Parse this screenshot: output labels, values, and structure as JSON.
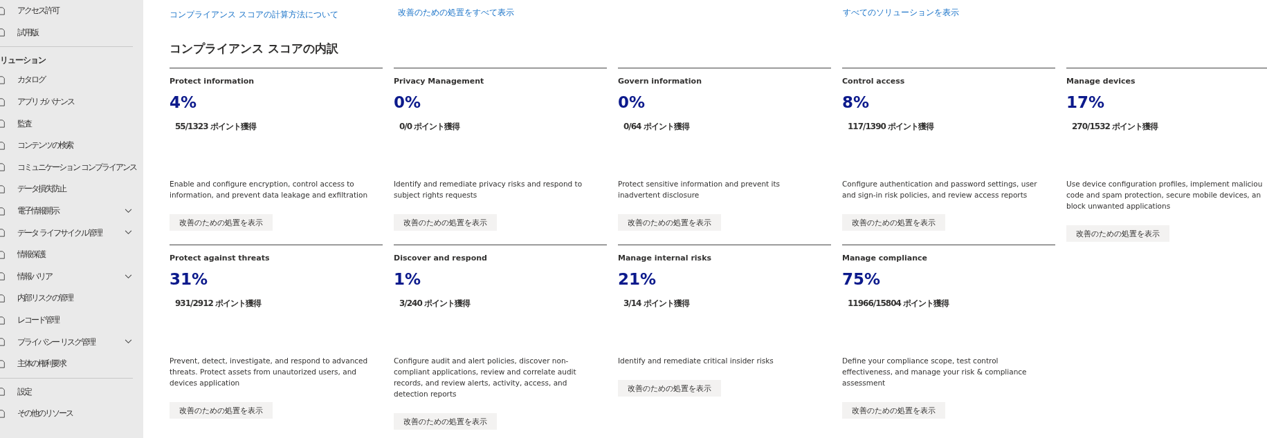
{
  "sidebar": {
    "top_items": [
      {
        "label": "アクセス許可"
      },
      {
        "label": "試用版"
      }
    ],
    "section_title": "リューション",
    "items": [
      {
        "label": "カタログ",
        "kind": "link"
      },
      {
        "label": "アプリ ガバナンス",
        "kind": "link"
      },
      {
        "label": "監査",
        "kind": "link"
      },
      {
        "label": "コンテンツの検索",
        "kind": "link"
      },
      {
        "label": "コミュニケーション コンプライアンス",
        "kind": "link"
      },
      {
        "label": "データ損失防止",
        "kind": "link"
      },
      {
        "label": "電子情報開示",
        "kind": "group"
      },
      {
        "label": "データ ライフサイクル管理",
        "kind": "group"
      },
      {
        "label": "情報保護",
        "kind": "link"
      },
      {
        "label": "情報バリア",
        "kind": "group"
      },
      {
        "label": "内部リスクの管理",
        "kind": "link"
      },
      {
        "label": "レコード管理",
        "kind": "link"
      },
      {
        "label": "プライバシー リスク管理",
        "kind": "group"
      },
      {
        "label": "主体の権利要求",
        "kind": "link"
      }
    ],
    "bottom_items": [
      {
        "label": "設定"
      },
      {
        "label": "その他のリソース"
      }
    ]
  },
  "links": [
    "コンプライアンス スコアの計算方法について",
    "改善のための処置をすべて表示",
    "すべてのソリューションを表示"
  ],
  "heading": "コンプライアンス スコアの内訳",
  "cards": [
    {
      "title": "Protect information",
      "percent": "4%",
      "points": "55/1323 ポイント獲得",
      "description": [
        "Enable and configure encryption, control access to",
        "information, and prevent data leakage and exfiltration"
      ],
      "button": "改善のための処置を表示"
    },
    {
      "title": "Privacy Management",
      "percent": "0%",
      "points": "0/0 ポイント獲得",
      "description": [
        "Identify and remediate privacy risks and respond to",
        "subject rights requests"
      ],
      "button": "改善のための処置を表示"
    },
    {
      "title": "Govern information",
      "percent": "0%",
      "points": "0/64 ポイント獲得",
      "description": [
        "Protect sensitive information and prevent its",
        "inadvertent disclosure"
      ],
      "button": "改善のための処置を表示"
    },
    {
      "title": "Control access",
      "percent": "8%",
      "points": "117/1390 ポイント獲得",
      "description": [
        "Configure authentication and password settings, user",
        "and sign-in risk policies, and review access reports"
      ],
      "button": "改善のための処置を表示"
    },
    {
      "title": "Manage devices",
      "percent": "17%",
      "points": "270/1532 ポイント獲得",
      "description": [
        "Use device configuration profiles, implement maliciou",
        "code and spam protection, secure mobile devices, an",
        "block unwanted applications"
      ],
      "button": "改善のための処置を表示"
    },
    {
      "title": "Protect against threats",
      "percent": "31%",
      "points": "931/2912 ポイント獲得",
      "description": [
        "Prevent, detect, investigate, and respond to advanced",
        "threats. Protect assets from unautorized users, and",
        "devices application"
      ],
      "button": "改善のための処置を表示"
    },
    {
      "title": "Discover and respond",
      "percent": "1%",
      "points": "3/240 ポイント獲得",
      "description": [
        "Configure audit and alert policies, discover non-",
        "compliant applications, review and correlate audit",
        "records, and review alerts, activity, access, and",
        "detection reports"
      ],
      "button": "改善のための処置を表示"
    },
    {
      "title": "Manage internal risks",
      "percent": "21%",
      "points": "3/14 ポイント獲得",
      "description": [
        "Identify and remediate critical insider risks"
      ],
      "button": "改善のための処置を表示"
    },
    {
      "title": "Manage compliance",
      "percent": "75%",
      "points": "11966/15804 ポイント獲得",
      "description": [
        "Define your compliance scope, test control",
        "effectiveness, and manage your risk & compliance",
        "assessment"
      ],
      "button": "改善のための処置を表示"
    }
  ]
}
